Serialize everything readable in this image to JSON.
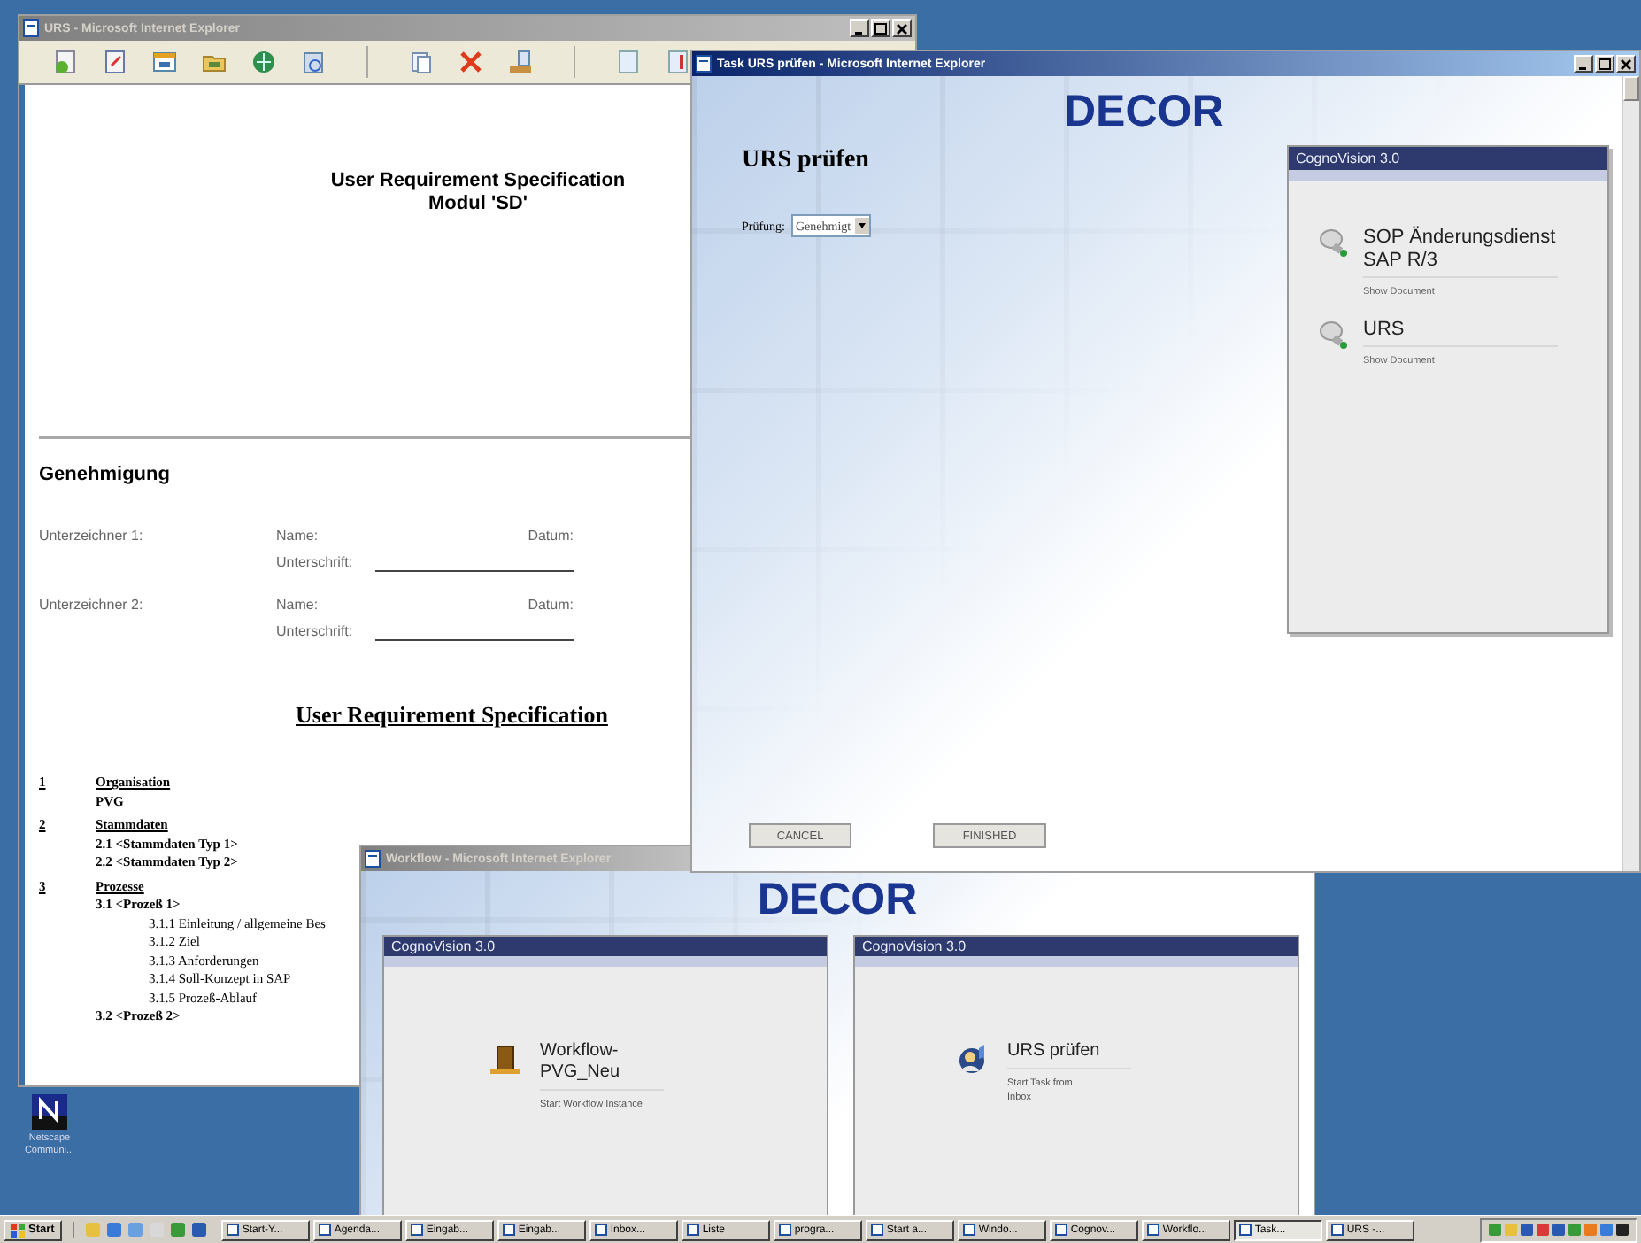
{
  "desktop_icon": {
    "label": "Netscape Communi..."
  },
  "document_window": {
    "title": "URS - Microsoft Internet Explorer",
    "active": false,
    "heading": [
      "User Requirement Specification",
      "Modul 'SD'"
    ],
    "section": "Genehmigung",
    "signers": [
      {
        "label": "Unterzeichner 1:",
        "name_label": "Name:",
        "date_label": "Datum:",
        "signature_label": "Unterschrift:"
      },
      {
        "label": "Unterzeichner 2:",
        "name_label": "Name:",
        "date_label": "Datum:",
        "signature_label": "Unterschrift:"
      }
    ],
    "outline_title": "User Requirement Specification",
    "outline": [
      {
        "number": "1",
        "title": "Organisation",
        "children": [
          {
            "text": "PVG"
          }
        ]
      },
      {
        "number": "2",
        "title": "Stammdaten",
        "children": [
          {
            "text": "2.1 <Stammdaten Typ 1>"
          },
          {
            "text": "2.2 <Stammdaten Typ 2>"
          }
        ]
      },
      {
        "number": "3",
        "title": "Prozesse",
        "children": [
          {
            "text": "3.1 <Prozeß 1>",
            "children": [
              {
                "text": "3.1.1 Einleitung / allgemeine Bes"
              },
              {
                "text": "3.1.2 Ziel"
              },
              {
                "text": "3.1.3 Anforderungen"
              },
              {
                "text": "3.1.4 Soll-Konzept in SAP"
              },
              {
                "text": "3.1.5 Prozeß-Ablauf"
              }
            ]
          },
          {
            "text": "3.2 <Prozeß 2>"
          }
        ]
      }
    ]
  },
  "task_window": {
    "title": "Task URS prüfen - Microsoft Internet Explorer",
    "active": true,
    "logo": "DECOR",
    "heading": "URS prüfen",
    "field": {
      "label": "Prüfung:",
      "value": "Genehmigt"
    },
    "panel": {
      "title": "CognoVision 3.0",
      "items": [
        {
          "title": "SOP Änderungsdienst SAP R/3",
          "link": "Show Document"
        },
        {
          "title": "URS",
          "link": "Show Document"
        }
      ]
    },
    "buttons": [
      "CANCEL",
      "FINISHED"
    ]
  },
  "workflow_window": {
    "title": "Workflow - Microsoft Internet Explorer",
    "active": false,
    "logo": "DECOR",
    "panels": [
      {
        "title": "CognoVision 3.0",
        "item": {
          "kind": "workflow",
          "title": "Workflow-PVG_Neu",
          "lines": [
            "Start Workflow Instance"
          ]
        }
      },
      {
        "title": "CognoVision 3.0",
        "item": {
          "kind": "task",
          "title": "URS prüfen",
          "lines": [
            "Start Task from",
            "Inbox"
          ]
        }
      }
    ]
  },
  "taskbar": {
    "start": "Start",
    "buttons": [
      {
        "label": "Start-Y...",
        "selected": false
      },
      {
        "label": "Agenda...",
        "selected": false
      },
      {
        "label": "Eingab...",
        "selected": false
      },
      {
        "label": "Eingab...",
        "selected": false
      },
      {
        "label": "Inbox...",
        "selected": false
      },
      {
        "label": "Liste",
        "selected": false
      },
      {
        "label": "progra...",
        "selected": false
      },
      {
        "label": "Start a...",
        "selected": false
      },
      {
        "label": "Windo...",
        "selected": false
      },
      {
        "label": "Cognov...",
        "selected": false
      },
      {
        "label": "Workflo...",
        "selected": false
      },
      {
        "label": "Task...",
        "selected": true
      },
      {
        "label": "URS -...",
        "selected": false
      }
    ]
  }
}
